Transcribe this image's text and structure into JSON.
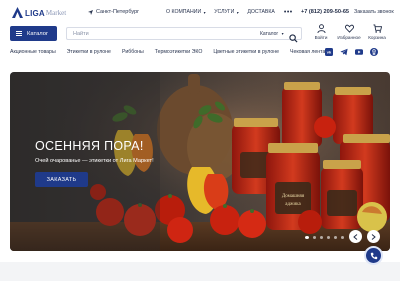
{
  "brand": {
    "name": "LIGA",
    "sub": "Market"
  },
  "header": {
    "city": "Санкт-Петербург",
    "nav": [
      {
        "label": "О КОМПАНИИ",
        "dropdown": true
      },
      {
        "label": "УСЛУГИ",
        "dropdown": true
      },
      {
        "label": "ДОСТАВКА",
        "dropdown": false
      }
    ],
    "more": "•••",
    "phone": "+7 (812) 209-50-65",
    "callback": "Заказать звонок"
  },
  "search": {
    "catalog_label": "Каталог",
    "placeholder": "Найти",
    "category": "Каталог"
  },
  "user_icons": [
    {
      "icon": "user-icon",
      "label": "Войти"
    },
    {
      "icon": "heart-icon",
      "label": "Избранное"
    },
    {
      "icon": "cart-icon",
      "label": "Корзина"
    }
  ],
  "categories": [
    "Акционные товары",
    "Этикетки в рулоне",
    "Риббоны",
    "Термоэтикетки ЭКО",
    "Цветные этикетки в рулоне",
    "Чековая лента"
  ],
  "socials": [
    "vk-icon",
    "telegram-icon",
    "youtube-icon",
    "ok-icon"
  ],
  "hero": {
    "title": "ОСЕННЯЯ ПОРА!",
    "subtitle": "Очей очарованье — этикетки от Лига Маркет!",
    "button": "ЗАКАЗАТЬ",
    "jar_label": "Домашняя аджика",
    "slides_total": 6,
    "active_slide": 1
  },
  "colors": {
    "primary": "#1f3a8a",
    "accent_red": "#d7281b",
    "text": "#1f2a44"
  }
}
